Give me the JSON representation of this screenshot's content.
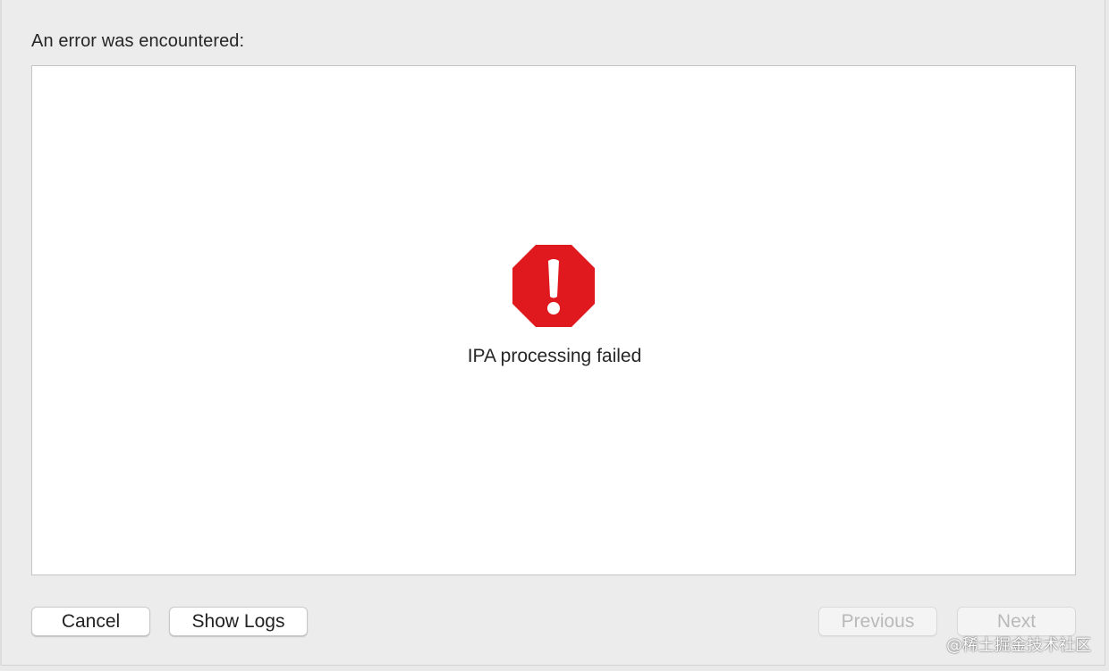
{
  "dialog": {
    "prompt": "An error was encountered:",
    "error_icon": "stop-exclamation-icon",
    "error_message": "IPA processing failed",
    "colors": {
      "error_red": "#e0191f",
      "content_bg": "#ffffff",
      "window_bg": "#ececec"
    }
  },
  "buttons": {
    "cancel_label": "Cancel",
    "show_logs_label": "Show Logs",
    "previous_label": "Previous",
    "next_label": "Next",
    "previous_enabled": false,
    "next_enabled": false
  },
  "watermark": "@稀土掘金技术社区"
}
